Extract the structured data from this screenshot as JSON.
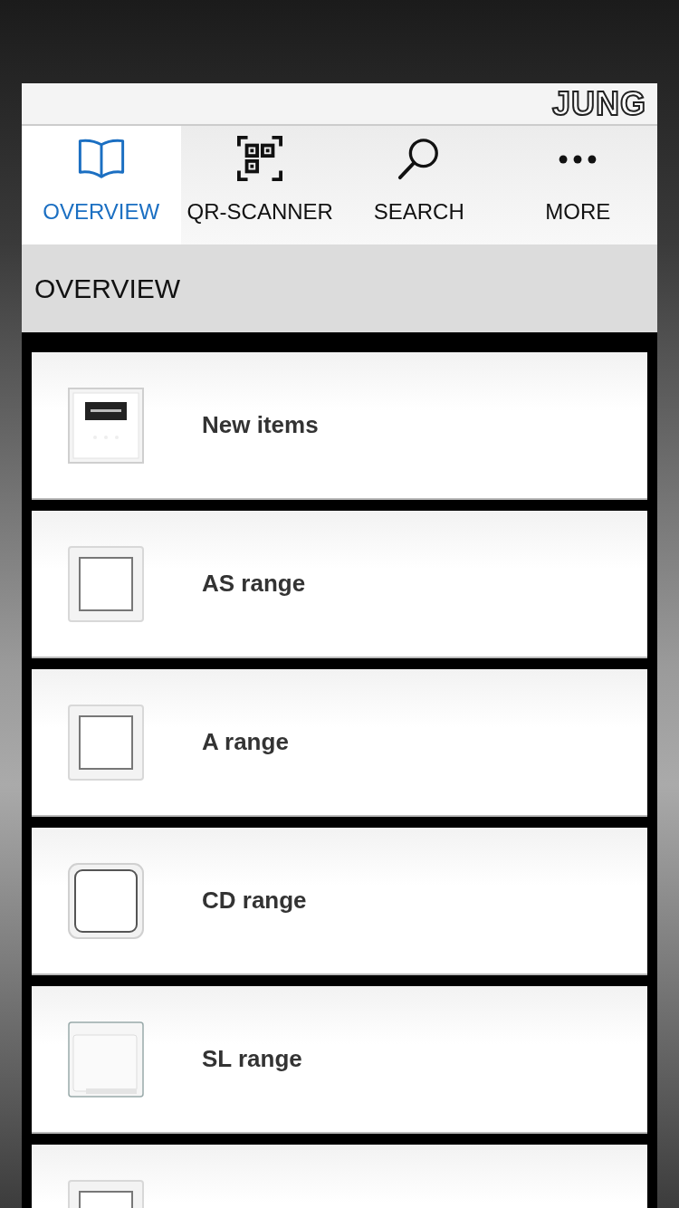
{
  "header": {
    "logo": "JUNG"
  },
  "tabs": [
    {
      "label": "OVERVIEW",
      "kind": "book",
      "selected": true
    },
    {
      "label": "QR-SCANNER",
      "kind": "qr",
      "selected": false
    },
    {
      "label": "SEARCH",
      "kind": "search",
      "selected": false
    },
    {
      "label": "MORE",
      "kind": "more",
      "selected": false
    }
  ],
  "section": {
    "title": "OVERVIEW"
  },
  "items": [
    {
      "label": "New items",
      "kind": "picture"
    },
    {
      "label": "AS range",
      "kind": "picture"
    },
    {
      "label": "A range",
      "kind": "picture"
    },
    {
      "label": "CD range",
      "kind": "picture"
    },
    {
      "label": "SL range",
      "kind": "picture"
    },
    {
      "kind": "picture"
    }
  ]
}
